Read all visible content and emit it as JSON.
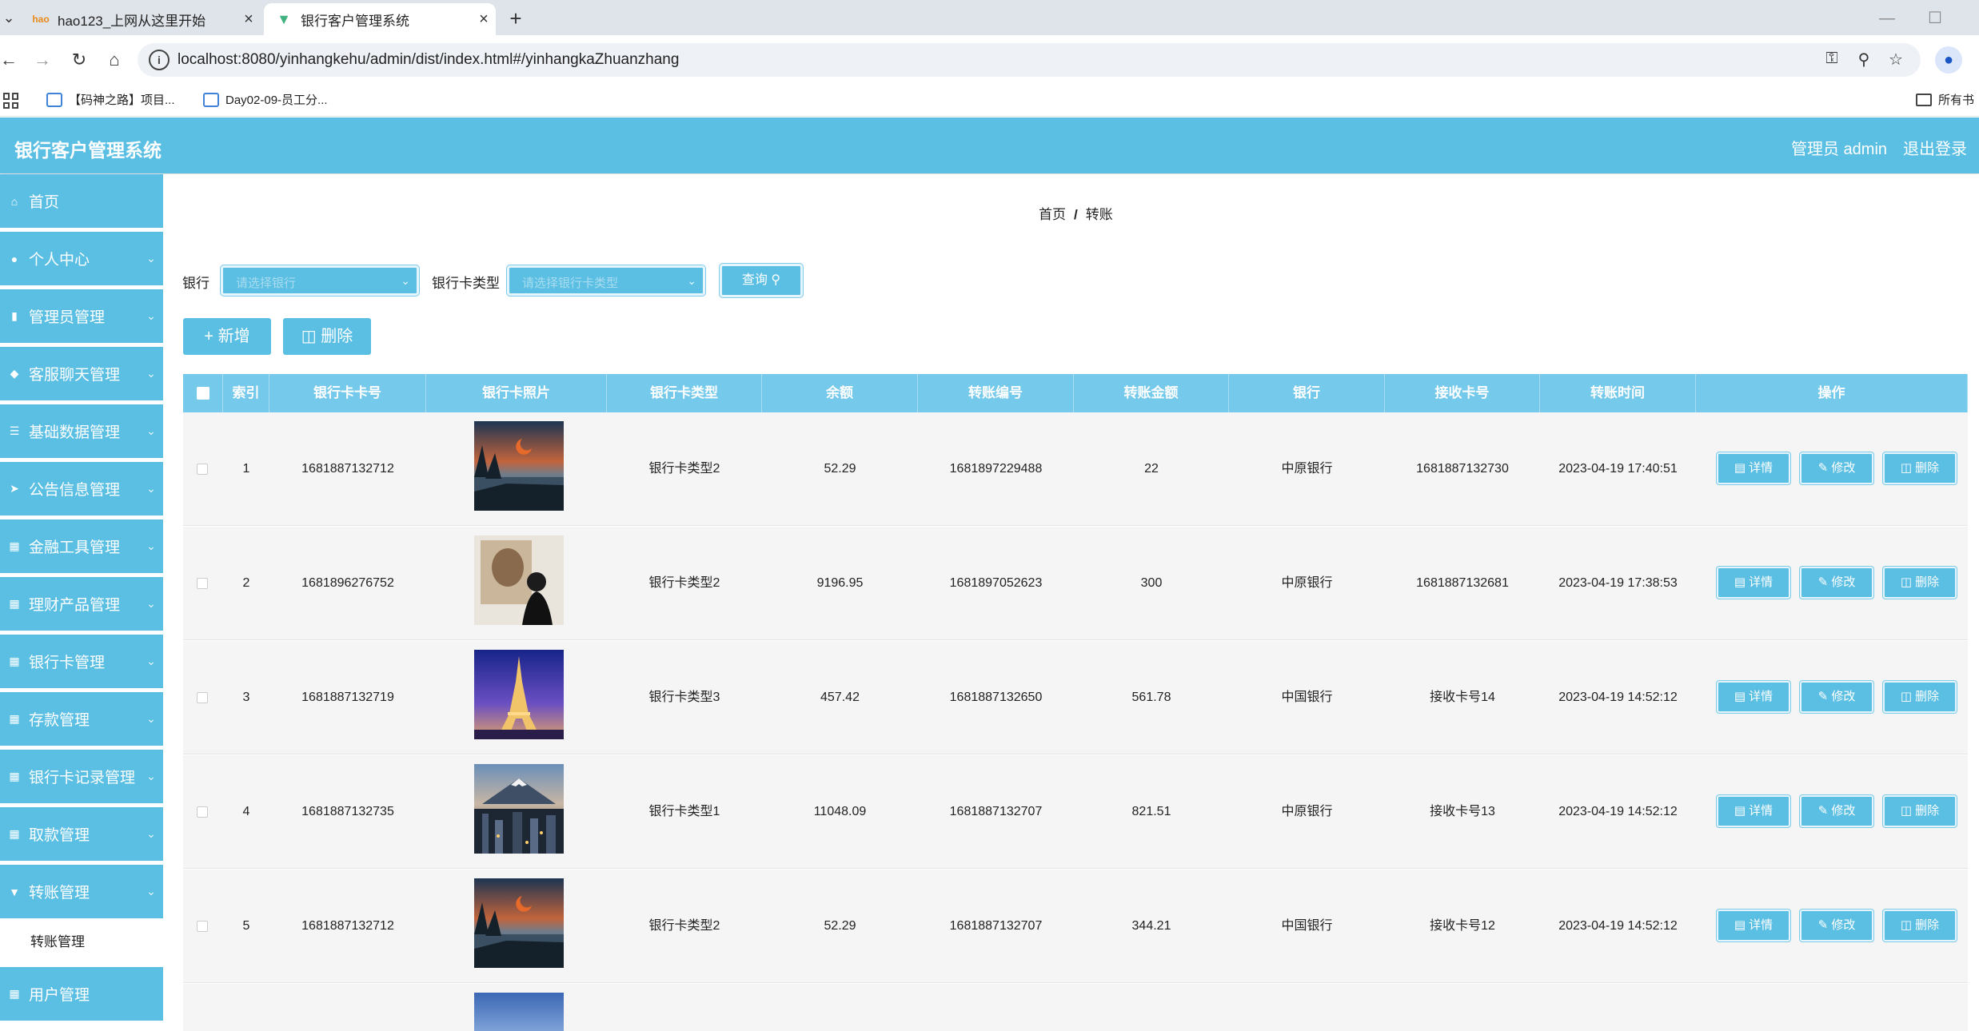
{
  "browser": {
    "tabs": [
      {
        "title": "hao123_上网从这里开始",
        "favicon": "hao123-icon"
      },
      {
        "title": "银行客户管理系统",
        "favicon": "vue-icon"
      }
    ],
    "url": "localhost:8080/yinhangkehu/admin/dist/index.html#/yinhangkaZhuanzhang",
    "bookmarks": [
      {
        "label": "【码神之路】项目..."
      },
      {
        "label": "Day02-09-员工分..."
      }
    ],
    "all_bookmarks_label": "所有书"
  },
  "app": {
    "title": "银行客户管理系统",
    "user": "管理员 admin",
    "logout": "退出登录"
  },
  "sidebar": {
    "items": [
      {
        "label": "首页",
        "icon": "home-icon"
      },
      {
        "label": "个人中心",
        "icon": "user-icon"
      },
      {
        "label": "管理员管理",
        "icon": "bar-chart-icon"
      },
      {
        "label": "客服聊天管理",
        "icon": "tag-icon"
      },
      {
        "label": "基础数据管理",
        "icon": "stack-icon"
      },
      {
        "label": "公告信息管理",
        "icon": "send-icon"
      },
      {
        "label": "金融工具管理",
        "icon": "grid-icon"
      },
      {
        "label": "理财产品管理",
        "icon": "grid-icon"
      },
      {
        "label": "银行卡管理",
        "icon": "grid-icon"
      },
      {
        "label": "存款管理",
        "icon": "grid-icon"
      },
      {
        "label": "银行卡记录管理",
        "icon": "grid-icon"
      },
      {
        "label": "取款管理",
        "icon": "grid-icon"
      },
      {
        "label": "转账管理",
        "icon": "funnel-icon"
      }
    ],
    "subitem": "转账管理",
    "last_item_partial": "用户管理"
  },
  "breadcrumb": {
    "home": "首页",
    "sep": "/",
    "current": "转账"
  },
  "filters": {
    "bank_label": "银行",
    "bank_placeholder": "请选择银行",
    "card_type_label": "银行卡类型",
    "card_type_placeholder": "请选择银行卡类型",
    "query_label": "查询"
  },
  "actions": {
    "add_label": "新增",
    "delete_label": "删除"
  },
  "table": {
    "columns": [
      "索引",
      "银行卡卡号",
      "银行卡照片",
      "银行卡类型",
      "余额",
      "转账编号",
      "转账金额",
      "银行",
      "接收卡号",
      "转账时间",
      "操作"
    ],
    "op_labels": {
      "detail": "详情",
      "edit": "修改",
      "delete": "删除"
    },
    "rows": [
      {
        "index": "1",
        "card_no": "1681887132712",
        "photo": "lake-sunset",
        "card_type": "银行卡类型2",
        "balance": "52.29",
        "transfer_no": "1681897229488",
        "amount": "22",
        "bank": "中原银行",
        "receive_no": "1681887132730",
        "time": "2023-04-19 17:40:51"
      },
      {
        "index": "2",
        "card_no": "1681896276752",
        "photo": "gallery-person",
        "card_type": "银行卡类型2",
        "balance": "9196.95",
        "transfer_no": "1681897052623",
        "amount": "300",
        "bank": "中原银行",
        "receive_no": "1681887132681",
        "time": "2023-04-19 17:38:53"
      },
      {
        "index": "3",
        "card_no": "1681887132719",
        "photo": "eiffel-tower",
        "card_type": "银行卡类型3",
        "balance": "457.42",
        "transfer_no": "1681887132650",
        "amount": "561.78",
        "bank": "中国银行",
        "receive_no": "接收卡号14",
        "time": "2023-04-19 14:52:12"
      },
      {
        "index": "4",
        "card_no": "1681887132735",
        "photo": "mount-fuji-city",
        "card_type": "银行卡类型1",
        "balance": "11048.09",
        "transfer_no": "1681887132707",
        "amount": "821.51",
        "bank": "中原银行",
        "receive_no": "接收卡号13",
        "time": "2023-04-19 14:52:12"
      },
      {
        "index": "5",
        "card_no": "1681887132712",
        "photo": "lake-sunset",
        "card_type": "银行卡类型2",
        "balance": "52.29",
        "transfer_no": "1681887132707",
        "amount": "344.21",
        "bank": "中国银行",
        "receive_no": "接收卡号12",
        "time": "2023-04-19 14:52:12"
      }
    ]
  },
  "colors": {
    "accent": "#5bbfe3",
    "header_row": "#75c9ea"
  }
}
